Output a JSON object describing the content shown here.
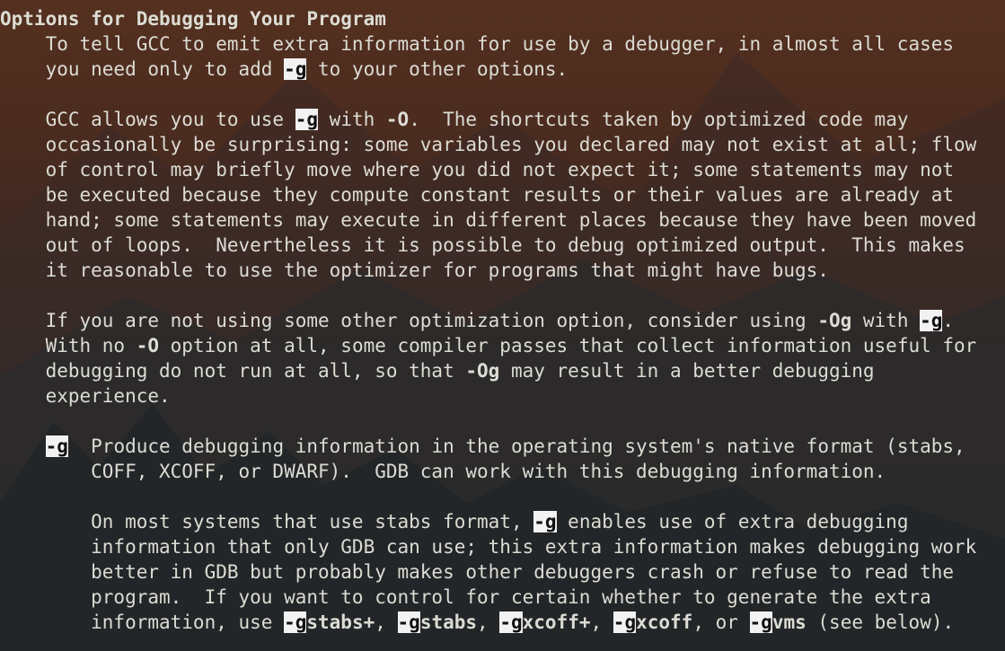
{
  "colors": {
    "text": "#dcdcd4",
    "highlight_bg": "#f2f2f2",
    "highlight_fg": "#111111",
    "background_top": "#54301f",
    "background_bottom": "#1f2427"
  },
  "terminal": {
    "lines": [
      [
        {
          "t": "Options for Debugging Your Program",
          "s": "b"
        }
      ],
      [
        {
          "t": "    To tell GCC to emit extra information for use by a debugger, in almost all cases"
        }
      ],
      [
        {
          "t": "    you need only to add "
        },
        {
          "t": "-g",
          "s": "hl"
        },
        {
          "t": " to your other options."
        }
      ],
      [],
      [
        {
          "t": "    GCC allows you to use "
        },
        {
          "t": "-g",
          "s": "hl"
        },
        {
          "t": " with "
        },
        {
          "t": "-O",
          "s": "b"
        },
        {
          "t": ".  The shortcuts taken by optimized code may"
        }
      ],
      [
        {
          "t": "    occasionally be surprising: some variables you declared may not exist at all; flow"
        }
      ],
      [
        {
          "t": "    of control may briefly move where you did not expect it; some statements may not"
        }
      ],
      [
        {
          "t": "    be executed because they compute constant results or their values are already at"
        }
      ],
      [
        {
          "t": "    hand; some statements may execute in different places because they have been moved"
        }
      ],
      [
        {
          "t": "    out of loops.  Nevertheless it is possible to debug optimized output.  This makes"
        }
      ],
      [
        {
          "t": "    it reasonable to use the optimizer for programs that might have bugs."
        }
      ],
      [],
      [
        {
          "t": "    If you are not using some other optimization option, consider using "
        },
        {
          "t": "-Og",
          "s": "b"
        },
        {
          "t": " with "
        },
        {
          "t": "-g",
          "s": "hl"
        },
        {
          "t": "."
        }
      ],
      [
        {
          "t": "    With no "
        },
        {
          "t": "-O",
          "s": "b"
        },
        {
          "t": " option at all, some compiler passes that collect information useful for"
        }
      ],
      [
        {
          "t": "    debugging do not run at all, so that "
        },
        {
          "t": "-Og",
          "s": "b"
        },
        {
          "t": " may result in a better debugging"
        }
      ],
      [
        {
          "t": "    experience."
        }
      ],
      [],
      [
        {
          "t": "    "
        },
        {
          "t": "-g",
          "s": "hl"
        },
        {
          "t": "  Produce debugging information in the operating system's native format (stabs,"
        }
      ],
      [
        {
          "t": "        COFF, XCOFF, or DWARF).  GDB can work with this debugging information."
        }
      ],
      [],
      [
        {
          "t": "        On most systems that use stabs format, "
        },
        {
          "t": "-g",
          "s": "hl"
        },
        {
          "t": " enables use of extra debugging"
        }
      ],
      [
        {
          "t": "        information that only GDB can use; this extra information makes debugging work"
        }
      ],
      [
        {
          "t": "        better in GDB but probably makes other debuggers crash or refuse to read the"
        }
      ],
      [
        {
          "t": "        program.  If you want to control for certain whether to generate the extra"
        }
      ],
      [
        {
          "t": "        information, use "
        },
        {
          "t": "-g",
          "s": "hl"
        },
        {
          "t": "stabs+",
          "s": "b"
        },
        {
          "t": ", "
        },
        {
          "t": "-g",
          "s": "hl"
        },
        {
          "t": "stabs",
          "s": "b"
        },
        {
          "t": ", "
        },
        {
          "t": "-g",
          "s": "hl"
        },
        {
          "t": "xcoff+",
          "s": "b"
        },
        {
          "t": ", "
        },
        {
          "t": "-g",
          "s": "hl"
        },
        {
          "t": "xcoff",
          "s": "b"
        },
        {
          "t": ", or "
        },
        {
          "t": "-g",
          "s": "hl"
        },
        {
          "t": "vms",
          "s": "b"
        },
        {
          "t": " (see below)."
        }
      ]
    ]
  }
}
